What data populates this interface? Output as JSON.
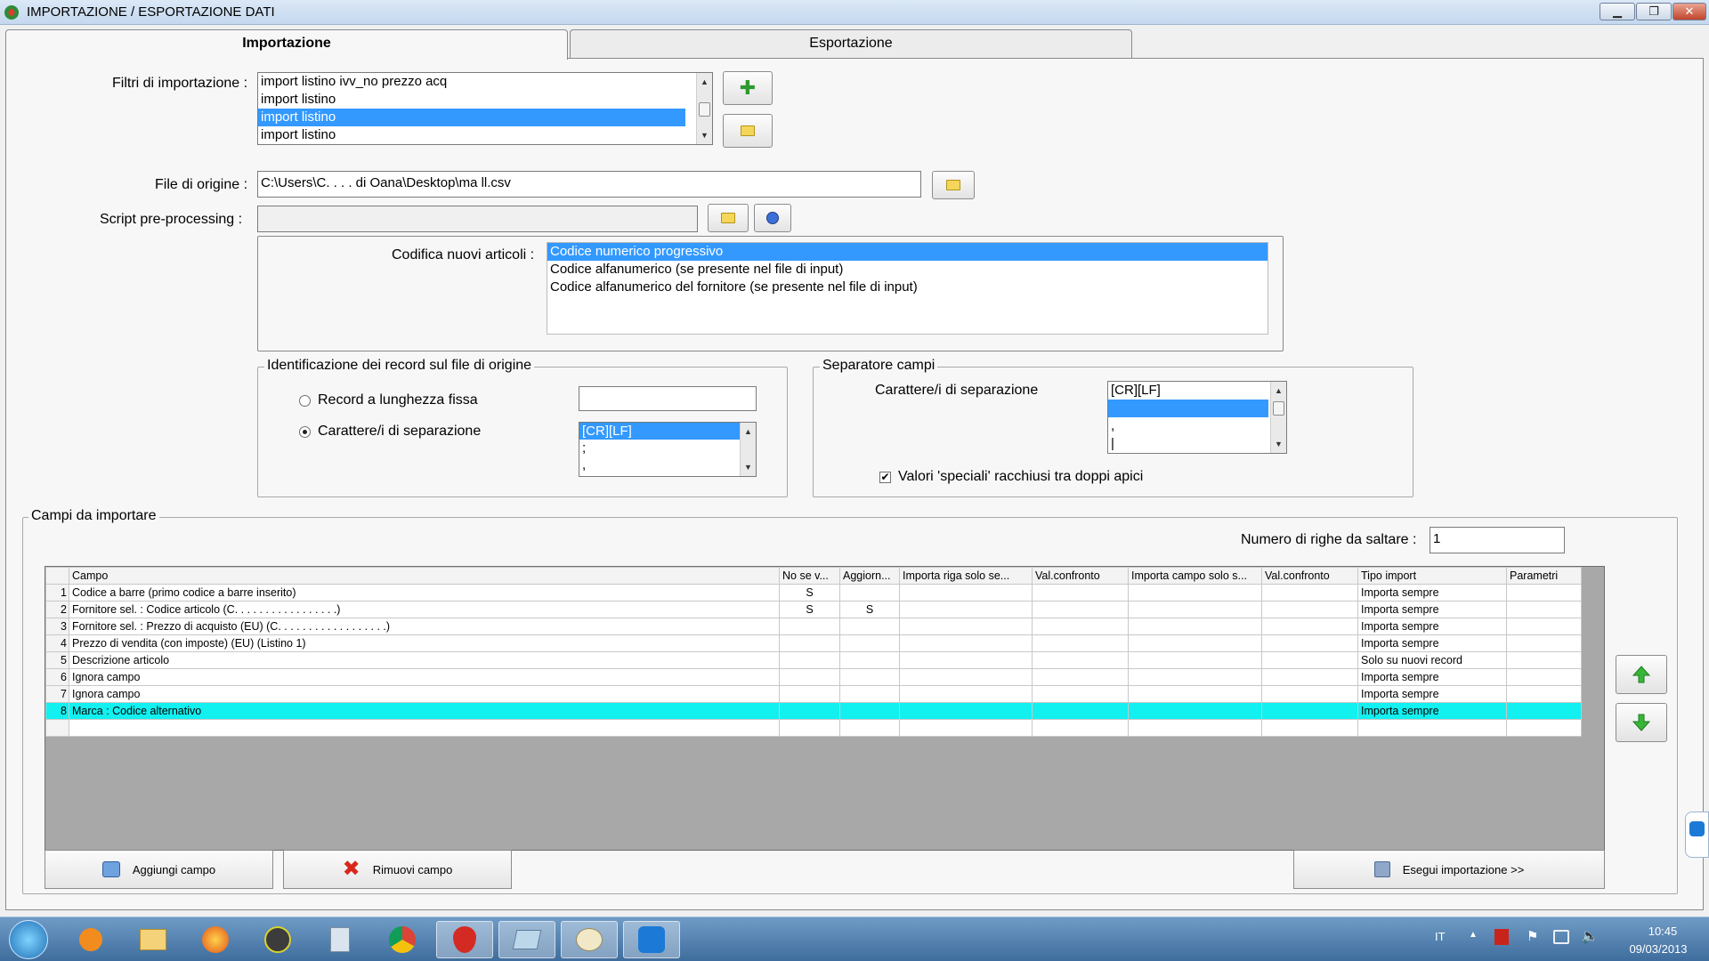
{
  "window": {
    "title": "IMPORTAZIONE / ESPORTAZIONE DATI",
    "minimize": "▁",
    "restore": "❐",
    "close": "✕"
  },
  "tabs": [
    {
      "label": "Importazione",
      "active": true
    },
    {
      "label": "Esportazione",
      "active": false
    }
  ],
  "filters": {
    "label": "Filtri di importazione :",
    "items": [
      "import listino ivv_no prezzo acq",
      "import listino",
      "import listino",
      "import listino"
    ],
    "selected_index": 2
  },
  "file_origin": {
    "label": "File di origine :",
    "value": "C:\\Users\\C. . . . di Oana\\Desktop\\ma       ll.csv"
  },
  "script": {
    "label": "Script pre-processing :",
    "value": ""
  },
  "codifica": {
    "label": "Codifica nuovi articoli :",
    "items": [
      "Codice numerico progressivo",
      "Codice alfanumerico (se presente nel file di input)",
      "Codice alfanumerico del fornitore (se presente nel file di input)"
    ],
    "selected_index": 0
  },
  "identification": {
    "title": "Identificazione dei record sul file di origine",
    "radio_fixed": "Record a lunghezza fissa",
    "radio_sep": "Carattere/i di separazione",
    "fixed_value": "",
    "sep_items": [
      "[CR][LF]",
      ";",
      ","
    ]
  },
  "field_sep": {
    "title": "Separatore campi",
    "label": "Carattere/i di separazione",
    "items": [
      "[CR][LF]",
      "",
      ",",
      "|"
    ],
    "checkbox_label": "Valori 'speciali' racchiusi tra doppi apici",
    "checked": true
  },
  "fields": {
    "title": "Campi da importare",
    "skip_label": "Numero di righe da saltare :",
    "skip_value": "1",
    "columns": [
      "Campo",
      "No se v...",
      "Aggiorn...",
      "Importa riga solo se...",
      "Val.confronto",
      "Importa campo solo s...",
      "Val.confronto",
      "Tipo import",
      "Parametri"
    ],
    "rows": [
      {
        "n": "1",
        "campo": "Codice a barre (primo codice a barre inserito)",
        "nosev": "S",
        "agg": "",
        "tipo": "Importa sempre"
      },
      {
        "n": "2",
        "campo": "Fornitore sel. : Codice articolo (C. . . . . . . . . . . . . . . . .)",
        "nosev": "S",
        "agg": "S",
        "tipo": "Importa sempre"
      },
      {
        "n": "3",
        "campo": "Fornitore sel. : Prezzo di acquisto (EU) (C. . . . . . . . . . . . . . . . . .)",
        "nosev": "",
        "agg": "",
        "tipo": "Importa sempre"
      },
      {
        "n": "4",
        "campo": "Prezzo di vendita (con imposte) (EU) (Listino 1)",
        "nosev": "",
        "agg": "",
        "tipo": "Importa sempre"
      },
      {
        "n": "5",
        "campo": "Descrizione articolo",
        "nosev": "",
        "agg": "",
        "tipo": "Solo su nuovi record"
      },
      {
        "n": "6",
        "campo": "Ignora campo",
        "nosev": "",
        "agg": "",
        "tipo": "Importa sempre"
      },
      {
        "n": "7",
        "campo": "Ignora campo",
        "nosev": "",
        "agg": "",
        "tipo": "Importa sempre"
      },
      {
        "n": "8",
        "campo": "Marca : Codice alternativo",
        "nosev": "",
        "agg": "",
        "tipo": "Importa sempre"
      }
    ],
    "selected_row": 7
  },
  "buttons": {
    "add_field": "Aggiungi campo",
    "remove_field": "Rimuovi campo",
    "run_import": "Esegui importazione >>"
  },
  "taskbar": {
    "lang": "IT",
    "time": "10:45",
    "date": "09/03/2013"
  },
  "colors": {
    "selection": "#3399ff",
    "grid_selected": "#12f0f0",
    "taskbar": "#4f7fb0"
  }
}
